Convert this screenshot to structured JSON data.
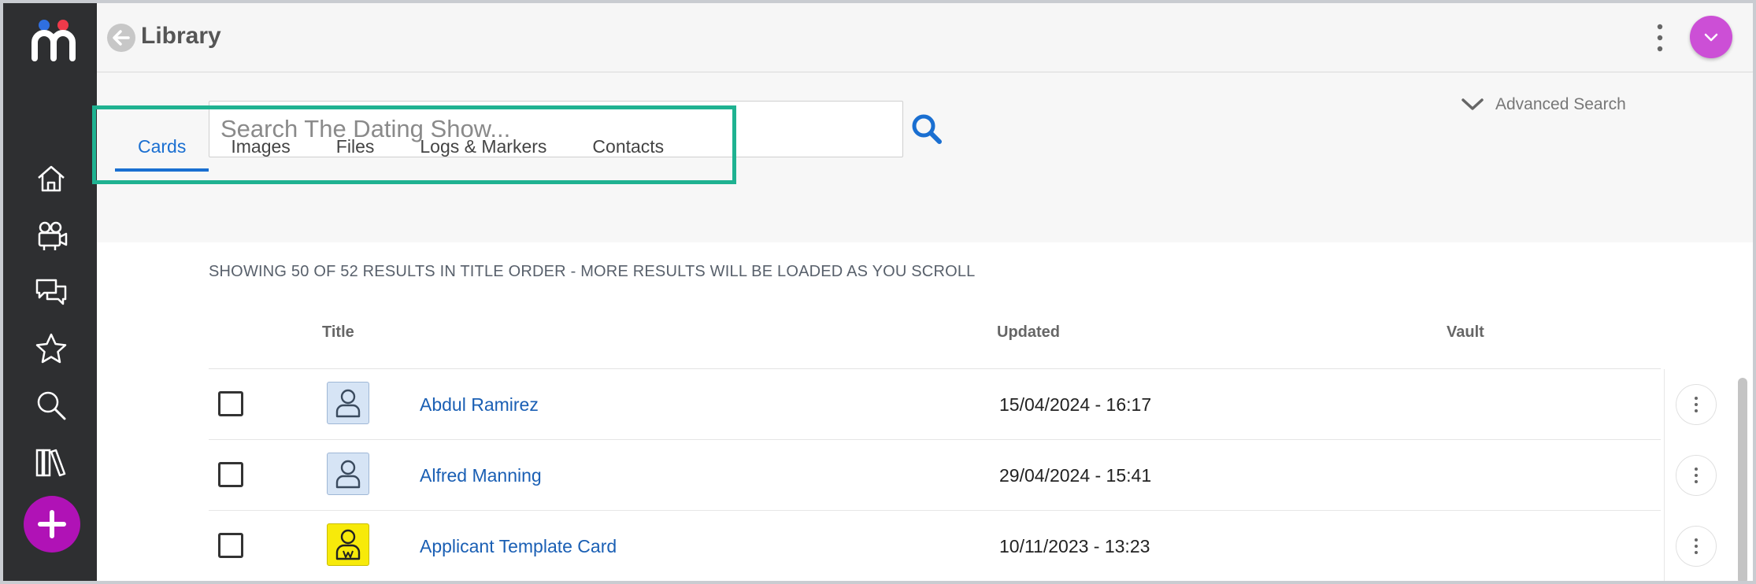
{
  "app": {
    "title": "Library"
  },
  "sidebar": {
    "items": [
      {
        "icon": "home-icon"
      },
      {
        "icon": "camera-icon"
      },
      {
        "icon": "chat-icon"
      },
      {
        "icon": "star-icon"
      },
      {
        "icon": "search-icon"
      },
      {
        "icon": "library-icon"
      }
    ],
    "add_icon": "plus-icon"
  },
  "search": {
    "placeholder": "Search The Dating Show...",
    "value": ""
  },
  "advanced_search": {
    "label": "Advanced Search"
  },
  "tabs": [
    {
      "label": "Cards",
      "active": true
    },
    {
      "label": "Images",
      "active": false
    },
    {
      "label": "Files",
      "active": false
    },
    {
      "label": "Logs & Markers",
      "active": false
    },
    {
      "label": "Contacts",
      "active": false
    }
  ],
  "results": {
    "info": "SHOWING 50 OF 52 RESULTS IN TITLE ORDER - MORE RESULTS WILL BE LOADED AS YOU SCROLL",
    "columns": {
      "title": "Title",
      "updated": "Updated",
      "vault": "Vault"
    },
    "rows": [
      {
        "title": "Abdul Ramirez",
        "updated": "15/04/2024 - 16:17",
        "thumb": "person-icon"
      },
      {
        "title": "Alfred Manning",
        "updated": "29/04/2024 - 15:41",
        "thumb": "person-icon"
      },
      {
        "title": "Applicant Template Card",
        "updated": "10/11/2023 - 13:23",
        "thumb": "applicant-icon"
      }
    ]
  },
  "colors": {
    "sidebar_bg": "#2e2f31",
    "accent_blue": "#1a6fd1",
    "link_blue": "#1a5fb4",
    "add_button": "#b012b6",
    "profile_button": "#cc4fd6",
    "highlight_outline": "#1fb291",
    "thumb_person_bg": "#d6e4f5",
    "thumb_applicant_bg": "#f7ea0a"
  }
}
